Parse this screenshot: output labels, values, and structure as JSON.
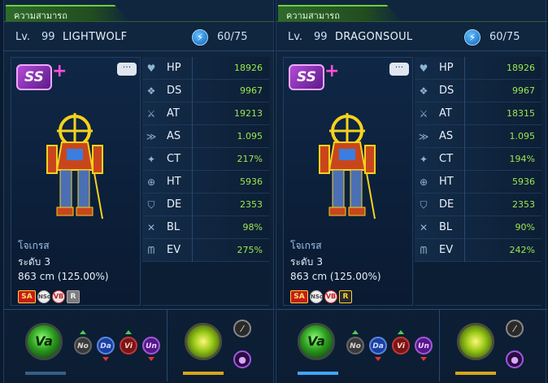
{
  "colors": {
    "panel_bg": "#10263f",
    "tab_accent": "#6ccf3e",
    "stat_value": "#9be84f",
    "mon_name": "#9ec4ea"
  },
  "panels": [
    {
      "tab_label": "ความสามารถ",
      "lv_label": "Lv.",
      "lv_value": "99",
      "player_name": "LIGHTWOLF",
      "energy_icon": "lightning-bolt-icon",
      "energy": "60/75",
      "grade": "SS",
      "grade_plus": "+",
      "chat_label": "···",
      "digimon_name": "โจเกรส",
      "level_label": "ระดับ",
      "level_value": "3",
      "size": "863 cm (125.00%)",
      "badges": {
        "sa": "SA",
        "nso": "NSo",
        "vb": "VB",
        "r": "R"
      },
      "stats": [
        {
          "icon": "heart-icon",
          "name": "HP",
          "value": "18926"
        },
        {
          "icon": "ds-icon",
          "name": "DS",
          "value": "9967"
        },
        {
          "icon": "sword-icon",
          "name": "AT",
          "value": "19213"
        },
        {
          "icon": "attack-speed-icon",
          "name": "AS",
          "value": "1.095"
        },
        {
          "icon": "critical-icon",
          "name": "CT",
          "value": "217%"
        },
        {
          "icon": "crosshair-icon",
          "name": "HT",
          "value": "5936"
        },
        {
          "icon": "shield-icon",
          "name": "DE",
          "value": "2353"
        },
        {
          "icon": "block-icon",
          "name": "BL",
          "value": "98%"
        },
        {
          "icon": "evade-icon",
          "name": "EV",
          "value": "275%"
        }
      ],
      "element": "Va",
      "attributes": {
        "no": "No",
        "da": "Da",
        "vi": "Vi",
        "un": "Un"
      }
    },
    {
      "tab_label": "ความสามารถ",
      "lv_label": "Lv.",
      "lv_value": "99",
      "player_name": "DRAGONSOUL",
      "energy_icon": "lightning-bolt-icon",
      "energy": "60/75",
      "grade": "SS",
      "grade_plus": "+",
      "chat_label": "···",
      "digimon_name": "โจเกรส",
      "level_label": "ระดับ",
      "level_value": "3",
      "size": "863 cm (125.00%)",
      "badges": {
        "sa": "SA",
        "nso": "NSo",
        "vb": "VB",
        "r": "R"
      },
      "stats": [
        {
          "icon": "heart-icon",
          "name": "HP",
          "value": "18926"
        },
        {
          "icon": "ds-icon",
          "name": "DS",
          "value": "9967"
        },
        {
          "icon": "sword-icon",
          "name": "AT",
          "value": "18315"
        },
        {
          "icon": "attack-speed-icon",
          "name": "AS",
          "value": "1.095"
        },
        {
          "icon": "critical-icon",
          "name": "CT",
          "value": "194%"
        },
        {
          "icon": "crosshair-icon",
          "name": "HT",
          "value": "5936"
        },
        {
          "icon": "shield-icon",
          "name": "DE",
          "value": "2353"
        },
        {
          "icon": "block-icon",
          "name": "BL",
          "value": "90%"
        },
        {
          "icon": "evade-icon",
          "name": "EV",
          "value": "242%"
        }
      ],
      "element": "Va",
      "attributes": {
        "no": "No",
        "da": "Da",
        "vi": "Vi",
        "un": "Un"
      }
    }
  ]
}
